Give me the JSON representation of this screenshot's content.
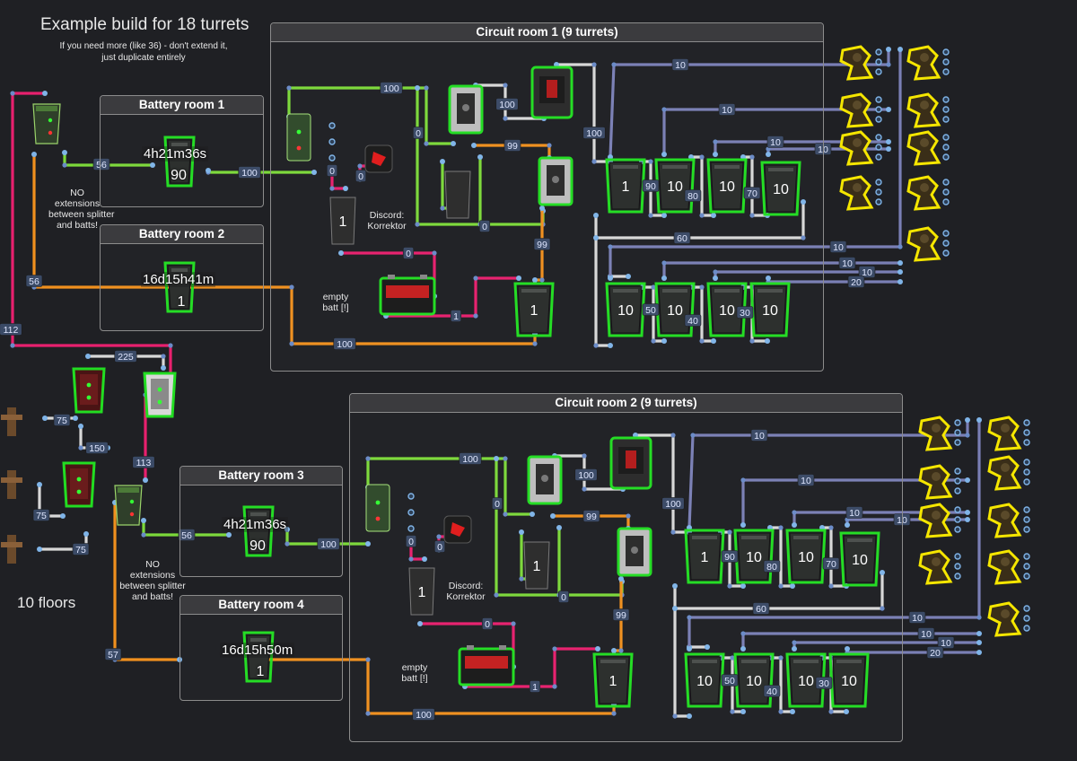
{
  "header": {
    "title": "Example build for 18 turrets",
    "subtitle_line1": "If you need more (like 36) - don't extend it,",
    "subtitle_line2": "just duplicate entirely"
  },
  "floors_label": "10 floors",
  "rooms": {
    "battery1": "Battery room 1",
    "battery2": "Battery room 2",
    "battery3": "Battery room 3",
    "battery4": "Battery room 4",
    "circuit1": "Circuit room 1 (9 turrets)",
    "circuit2": "Circuit room 2 (9 turrets)"
  },
  "timers": {
    "battery1": "4h21m36s",
    "battery2": "16d15h41m",
    "battery3": "4h21m36s",
    "battery4": "16d15h50m"
  },
  "battery_values": {
    "battery1": "90",
    "battery2": "1",
    "battery3": "90",
    "battery4": "1"
  },
  "notes": {
    "no_ext_1": "NO\nextensions\nbetween splitter\nand batts!",
    "no_ext_2": "NO\nextensions\nbetween splitter\nand batts!",
    "discord_1": "Discord:\nKorrektor",
    "discord_2": "Discord:\nKorrektor",
    "empty_batt_1": "empty\nbatt [!]",
    "empty_batt_2": "empty\nbatt [!]"
  },
  "colors": {
    "background": "#1f2024",
    "green_wire": "#7cd93a",
    "orange_wire": "#f0901e",
    "pink_wire": "#e8206e",
    "white_wire": "#d8d8d8",
    "blue_wire": "#7a7fb5",
    "selected_outline": "#22dd22",
    "turret_highlight": "#f5e600",
    "node_dot": "#7fb4e8"
  },
  "icons": {
    "counter": "counter-icon",
    "turret": "auto-turret-icon",
    "splitter": "splitter-icon",
    "switch": "switch-icon",
    "battery": "large-battery-icon",
    "and_gate": "and-switch-icon",
    "generator": "generator-icon"
  },
  "wire_labels": {
    "w1": "56",
    "w2": "100",
    "w3": "56",
    "w4": "112",
    "w5": "225",
    "w6": "75",
    "w7": "150",
    "w8": "113",
    "w9": "75",
    "w10": "75",
    "w11": "56",
    "w12": "100",
    "w13": "57",
    "w14": "100",
    "w15": "0",
    "w16": "100",
    "w17": "99",
    "w18": "0",
    "w19": "0",
    "w20": "99",
    "w21": "0",
    "w22": "1",
    "w23": "100",
    "w24": "100",
    "w25": "10",
    "w26": "10",
    "w27": "10",
    "w28": "10",
    "w29": "90",
    "w30": "80",
    "w31": "70",
    "w32": "60",
    "w33": "10",
    "w34": "10",
    "w35": "10",
    "w36": "20",
    "w37": "50",
    "w38": "40",
    "w39": "30",
    "w40": "100",
    "w41": "0",
    "w42": "100",
    "w43": "99",
    "w44": "0",
    "w45": "0",
    "w46": "99",
    "w47": "0",
    "w48": "1",
    "w49": "100",
    "w50": "100",
    "w51": "10",
    "w52": "10",
    "w53": "10",
    "w54": "10",
    "w55": "90",
    "w56": "80",
    "w57": "70",
    "w58": "60",
    "w59": "10",
    "w60": "10",
    "w61": "10",
    "w62": "20",
    "w63": "50",
    "w64": "40",
    "w65": "30"
  },
  "device_values": {
    "d1": "1",
    "d2": "1",
    "d3": "10",
    "d4": "10",
    "d5": "10",
    "d6": "10",
    "d7": "10",
    "d8": "10",
    "d9": "10",
    "d10": "10",
    "d11": "1",
    "d12": "1",
    "d13": "1",
    "d14": "10",
    "d15": "10",
    "d16": "10",
    "d17": "10",
    "d18": "10",
    "d19": "10",
    "d20": "10",
    "d21": "10",
    "d22": "1"
  }
}
